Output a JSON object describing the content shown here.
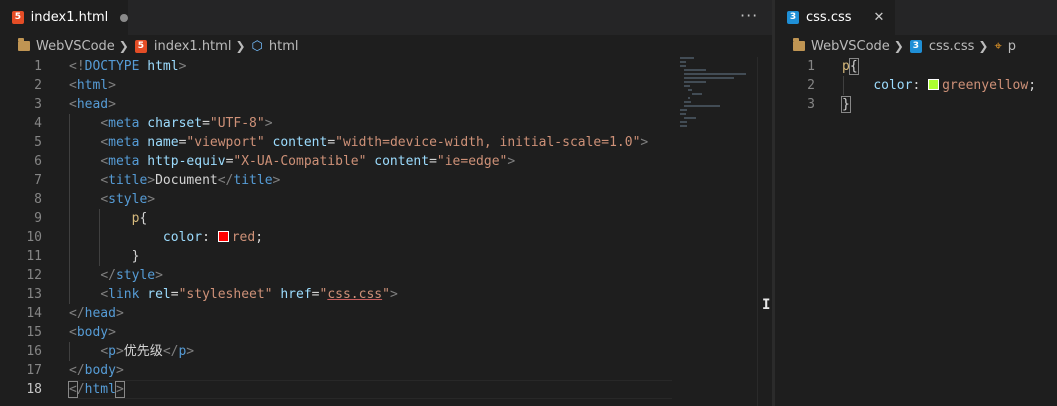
{
  "left": {
    "tab": {
      "icon": "5",
      "label": "index1.html"
    },
    "more_actions": "···",
    "breadcrumbs": [
      "WebVSCode",
      "index1.html",
      "html"
    ],
    "lines": [
      [
        [
          "t-punc",
          "<!"
        ],
        [
          "t-tag",
          "DOCTYPE"
        ],
        [
          "t-text",
          " "
        ],
        [
          "t-attr",
          "html"
        ],
        [
          "t-punc",
          ">"
        ]
      ],
      [
        [
          "t-punc",
          "<"
        ],
        [
          "t-tag",
          "html"
        ],
        [
          "t-punc",
          ">"
        ]
      ],
      [
        [
          "t-punc",
          "<"
        ],
        [
          "t-tag",
          "head"
        ],
        [
          "t-punc",
          ">"
        ]
      ],
      [
        [
          "t-text",
          "    "
        ],
        [
          "t-punc",
          "<"
        ],
        [
          "t-tag",
          "meta"
        ],
        [
          "t-text",
          " "
        ],
        [
          "t-attr",
          "charset"
        ],
        [
          "t-text",
          "="
        ],
        [
          "t-str",
          "\"UTF-8\""
        ],
        [
          "t-punc",
          ">"
        ]
      ],
      [
        [
          "t-text",
          "    "
        ],
        [
          "t-punc",
          "<"
        ],
        [
          "t-tag",
          "meta"
        ],
        [
          "t-text",
          " "
        ],
        [
          "t-attr",
          "name"
        ],
        [
          "t-text",
          "="
        ],
        [
          "t-str",
          "\"viewport\""
        ],
        [
          "t-text",
          " "
        ],
        [
          "t-attr",
          "content"
        ],
        [
          "t-text",
          "="
        ],
        [
          "t-str",
          "\"width=device-width, initial-scale=1.0\""
        ],
        [
          "t-punc",
          ">"
        ]
      ],
      [
        [
          "t-text",
          "    "
        ],
        [
          "t-punc",
          "<"
        ],
        [
          "t-tag",
          "meta"
        ],
        [
          "t-text",
          " "
        ],
        [
          "t-attr",
          "http-equiv"
        ],
        [
          "t-text",
          "="
        ],
        [
          "t-str",
          "\"X-UA-Compatible\""
        ],
        [
          "t-text",
          " "
        ],
        [
          "t-attr",
          "content"
        ],
        [
          "t-text",
          "="
        ],
        [
          "t-str",
          "\"ie=edge\""
        ],
        [
          "t-punc",
          ">"
        ]
      ],
      [
        [
          "t-text",
          "    "
        ],
        [
          "t-punc",
          "<"
        ],
        [
          "t-tag",
          "title"
        ],
        [
          "t-punc",
          ">"
        ],
        [
          "t-text",
          "Document"
        ],
        [
          "t-punc",
          "</"
        ],
        [
          "t-tag",
          "title"
        ],
        [
          "t-punc",
          ">"
        ]
      ],
      [
        [
          "t-text",
          "    "
        ],
        [
          "t-punc",
          "<"
        ],
        [
          "t-tag",
          "style"
        ],
        [
          "t-punc",
          ">"
        ]
      ],
      [
        [
          "t-text",
          "        "
        ],
        [
          "t-sel",
          "p"
        ],
        [
          "t-text",
          "{"
        ]
      ],
      [
        [
          "t-text",
          "            "
        ],
        [
          "t-prop",
          "color"
        ],
        [
          "t-text",
          ": "
        ],
        [
          "swatch",
          "#ff0000"
        ],
        [
          "t-str",
          "red"
        ],
        [
          "t-text",
          ";"
        ]
      ],
      [
        [
          "t-text",
          "        }"
        ]
      ],
      [
        [
          "t-text",
          "    "
        ],
        [
          "t-punc",
          "</"
        ],
        [
          "t-tag",
          "style"
        ],
        [
          "t-punc",
          ">"
        ]
      ],
      [
        [
          "t-text",
          "    "
        ],
        [
          "t-punc",
          "<"
        ],
        [
          "t-tag",
          "link"
        ],
        [
          "t-text",
          " "
        ],
        [
          "t-attr",
          "rel"
        ],
        [
          "t-text",
          "="
        ],
        [
          "t-str",
          "\"stylesheet\""
        ],
        [
          "t-text",
          " "
        ],
        [
          "t-attr",
          "href"
        ],
        [
          "t-text",
          "="
        ],
        [
          "t-str",
          "\""
        ],
        [
          "t-str und",
          "css.css"
        ],
        [
          "t-str",
          "\""
        ],
        [
          "t-punc",
          ">"
        ]
      ],
      [
        [
          "t-punc",
          "</"
        ],
        [
          "t-tag",
          "head"
        ],
        [
          "t-punc",
          ">"
        ]
      ],
      [
        [
          "t-punc",
          "<"
        ],
        [
          "t-tag",
          "body"
        ],
        [
          "t-punc",
          ">"
        ]
      ],
      [
        [
          "t-text",
          "    "
        ],
        [
          "t-punc",
          "<"
        ],
        [
          "t-tag",
          "p"
        ],
        [
          "t-punc",
          ">"
        ],
        [
          "t-text",
          "优先级"
        ],
        [
          "t-punc",
          "</"
        ],
        [
          "t-tag",
          "p"
        ],
        [
          "t-punc",
          ">"
        ]
      ],
      [
        [
          "t-punc",
          "</"
        ],
        [
          "t-tag",
          "body"
        ],
        [
          "t-punc",
          ">"
        ]
      ],
      [
        [
          "t-punc bracket",
          "<"
        ],
        [
          "t-punc",
          "/"
        ],
        [
          "t-tag",
          "html"
        ],
        [
          "t-punc bracket",
          ">"
        ]
      ]
    ]
  },
  "right": {
    "tab": {
      "icon": "3",
      "label": "css.css",
      "close": "✕"
    },
    "breadcrumbs": [
      "WebVSCode",
      "css.css",
      "p"
    ],
    "lines": [
      [
        [
          "t-sel",
          "p"
        ],
        [
          "t-text bracket",
          "{"
        ]
      ],
      [
        [
          "t-text",
          "    "
        ],
        [
          "t-prop",
          "color"
        ],
        [
          "t-text",
          ": "
        ],
        [
          "swatch",
          "#adff2f"
        ],
        [
          "t-str",
          "greenyellow"
        ],
        [
          "t-text",
          ";"
        ]
      ],
      [
        [
          "t-text bracket",
          "}"
        ]
      ]
    ]
  },
  "colors": {
    "background": "#1e1e1e",
    "tab_bar": "#252526",
    "html_icon": "#e44d26",
    "css_icon": "#1f8fd6"
  }
}
